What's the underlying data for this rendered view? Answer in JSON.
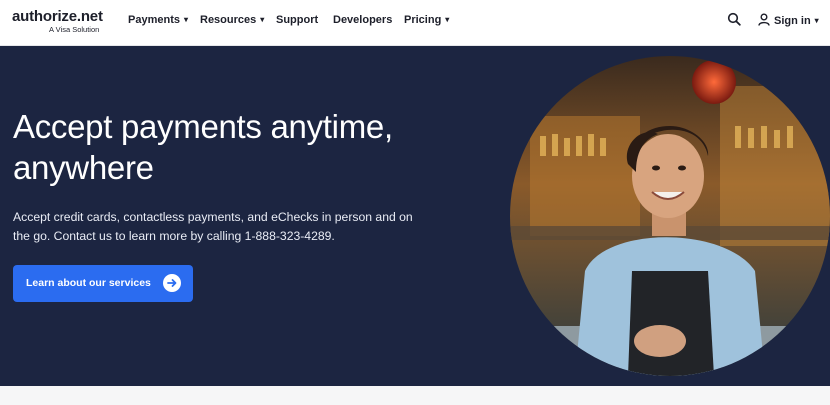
{
  "brand": {
    "name": "authorize.net",
    "tagline": "A Visa Solution"
  },
  "nav": {
    "items": [
      {
        "label": "Payments",
        "has_dropdown": true
      },
      {
        "label": "Resources",
        "has_dropdown": true
      },
      {
        "label": "Support",
        "has_dropdown": false
      },
      {
        "label": "Developers",
        "has_dropdown": false
      },
      {
        "label": "Pricing",
        "has_dropdown": true
      }
    ],
    "search_icon": "search-icon",
    "signin": {
      "label": "Sign in",
      "icon": "user-icon",
      "has_dropdown": true
    }
  },
  "hero": {
    "headline": "Accept payments anytime, anywhere",
    "subtext": "Accept credit cards, contactless payments, and eChecks in person and on the go. Contact us to learn more by calling 1-888-323-4289.",
    "cta_label": "Learn about our services",
    "cta_icon": "arrow-right-circle-icon"
  },
  "colors": {
    "hero_bg": "#1c2541",
    "cta_bg": "#2b6cf0",
    "nav_bg": "#ffffff"
  }
}
